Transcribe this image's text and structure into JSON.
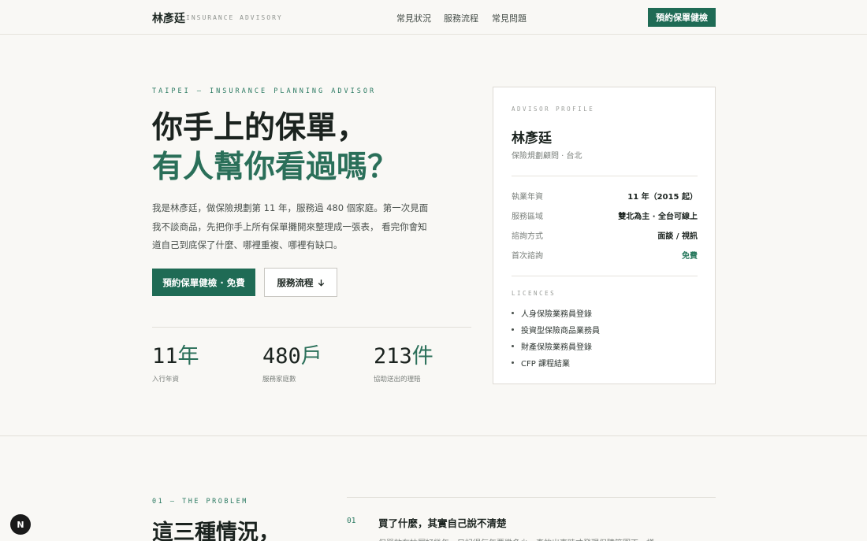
{
  "header": {
    "brand_name": "林彥廷",
    "brand_sub": "INSURANCE ADVISORY",
    "nav": [
      "常見狀況",
      "服務流程",
      "常見問題"
    ],
    "cta": "預約保單健檢"
  },
  "hero": {
    "eyebrow": "TAIPEI — INSURANCE PLANNING ADVISOR",
    "title_line1": "你手上的保單，",
    "title_line2": "有人幫你看過嗎？",
    "description": "我是林彥廷，做保險規劃第 11 年，服務過 480 個家庭。第一次見面我不談商品，先把你手上所有保單攤開來整理成一張表， 看完你會知道自己到底保了什麼、哪裡重複、哪裡有缺口。",
    "primary_button": "預約保單健檢 · 免費",
    "secondary_button": "服務流程",
    "secondary_icon": "arrow-down-icon",
    "stats": [
      {
        "number": "11",
        "unit": "年",
        "label": "入行年資"
      },
      {
        "number": "480",
        "unit": "戶",
        "label": "服務家庭數"
      },
      {
        "number": "213",
        "unit": "件",
        "label": "協助送出的理賠"
      }
    ]
  },
  "profile": {
    "eyebrow": "ADVISOR PROFILE",
    "name": "林彥廷",
    "role": "保險規劃顧問 · 台北",
    "info": [
      {
        "label": "執業年資",
        "value": "11 年（2015 起）"
      },
      {
        "label": "服務區域",
        "value": "雙北為主 · 全台可線上"
      },
      {
        "label": "諮詢方式",
        "value": "面談 / 視訊"
      },
      {
        "label": "首次諮詢",
        "value": "免費"
      }
    ],
    "licences_eyebrow": "LICENCES",
    "licences": [
      "人身保險業務員登錄",
      "投資型保險商品業務員",
      "財產保險業務員登錄",
      "CFP 課程結業"
    ]
  },
  "problem": {
    "eyebrow": "01 — THE PROBLEM",
    "title": "這三種情況，",
    "items": [
      {
        "num": "01",
        "title": "買了什麼，其實自己說不清楚",
        "text": "保單放在抽屜好幾年，只記得每年要繳多少，真的出事時才發現保障範圍不一樣"
      }
    ]
  },
  "badge": {
    "label": "N"
  },
  "colors": {
    "accent": "#1f6b55",
    "accent_text": "#2a6f59",
    "background": "#f9f8f5"
  }
}
